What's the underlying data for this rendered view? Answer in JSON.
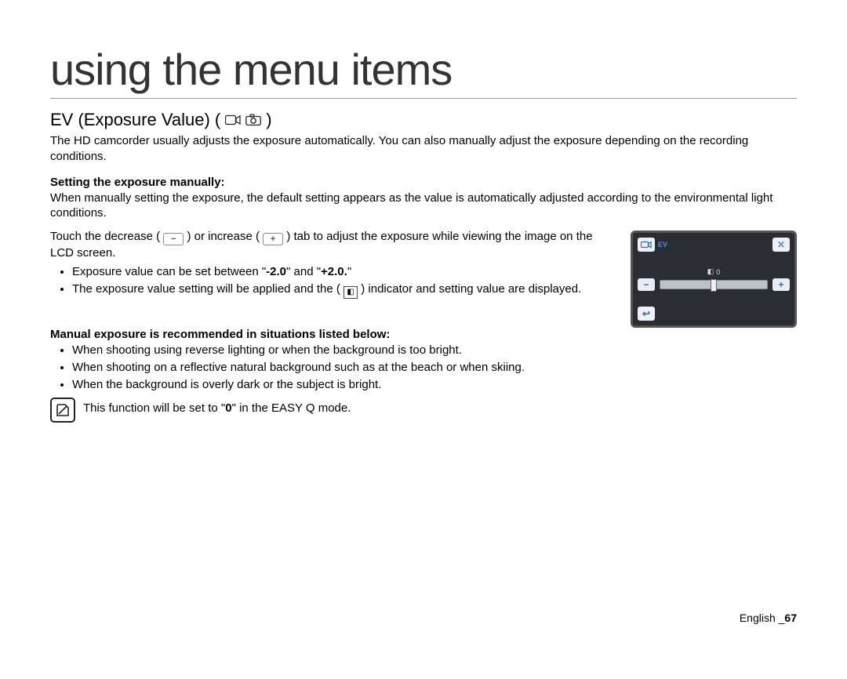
{
  "chapter_title": "using the menu items",
  "section": {
    "title": "EV (Exposure Value) (",
    "title_close": ")",
    "intro": "The HD camcorder usually adjusts the exposure automatically. You can also manually adjust the exposure depending on the recording conditions."
  },
  "manual": {
    "heading": "Setting the exposure manually:",
    "p1": "When manually setting the exposure, the default setting appears as the value is automatically adjusted according to the environmental light conditions.",
    "p2a": "Touch the decrease (",
    "p2b": ") or increase (",
    "p2c": ") tab to adjust the exposure while viewing the image on the LCD screen.",
    "bullets": {
      "b1a": "Exposure value can be set between \"",
      "b1_low": "-2.0",
      "b1_mid": "\" and \"",
      "b1_high": "+2.0.",
      "b1_end": "\"",
      "b2a": "The exposure value setting will be applied and the (",
      "b2b": ") indicator and setting value are displayed."
    }
  },
  "recommend": {
    "heading": "Manual exposure is recommended in situations listed below:",
    "items": [
      "When shooting using reverse lighting or when the background is too bright.",
      "When shooting on a reflective natural background such as at the beach or when skiing.",
      "When the background is overly dark or the subject is bright."
    ]
  },
  "note": {
    "text_a": "This function will be set to \"",
    "zero": "0",
    "text_b": "\" in the EASY Q mode."
  },
  "lcd": {
    "ev_label": "EV",
    "ev_value": "0",
    "minus": "−",
    "plus": "+",
    "close": "✕",
    "back": "↩"
  },
  "footer": {
    "lang": "English _",
    "page": "67"
  },
  "icons": {
    "video": "video-icon",
    "photo": "photo-icon",
    "minus_btn": "−",
    "plus_btn": "+",
    "ev_indicator": "◧"
  }
}
